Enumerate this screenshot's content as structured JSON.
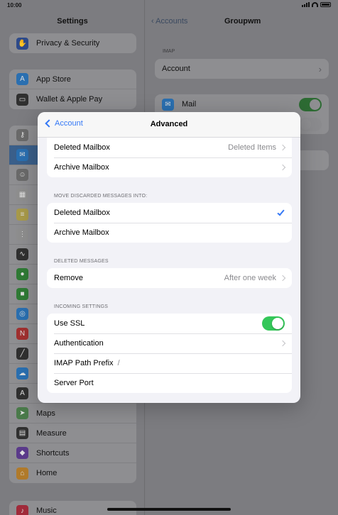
{
  "status": {
    "time": "10:00"
  },
  "sidebar": {
    "title": "Settings",
    "groups": [
      {
        "items": [
          {
            "label": "Privacy & Security",
            "icon": "hand-icon",
            "color": "#2d4a8a"
          }
        ]
      },
      {
        "items": [
          {
            "label": "App Store",
            "icon": "app-store-icon",
            "color": "#2a6fb0"
          },
          {
            "label": "Wallet & Apple Pay",
            "icon": "wallet-icon",
            "color": "#303030"
          }
        ]
      },
      {
        "items": [
          {
            "label": "",
            "icon": "key-icon",
            "color": "#6a6a6a"
          },
          {
            "label": "",
            "icon": "mail-icon",
            "color": "#2a6fb0",
            "selected": true
          },
          {
            "label": "",
            "icon": "contacts-icon",
            "color": "#6a6a6a"
          },
          {
            "label": "",
            "icon": "calendar-icon",
            "color": "#8e8e8e"
          },
          {
            "label": "",
            "icon": "notes-icon",
            "color": "#a89a4a"
          },
          {
            "label": "",
            "icon": "reminders-icon",
            "color": "#8e8e8e"
          },
          {
            "label": "",
            "icon": "voice-memos-icon",
            "color": "#303030"
          },
          {
            "label": "",
            "icon": "messages-icon",
            "color": "#2f7a35"
          },
          {
            "label": "",
            "icon": "facetime-icon",
            "color": "#2f7a35"
          },
          {
            "label": "",
            "icon": "safari-icon",
            "color": "#2a6fb0"
          },
          {
            "label": "",
            "icon": "news-icon",
            "color": "#a03030"
          },
          {
            "label": "",
            "icon": "stocks-icon",
            "color": "#303030"
          },
          {
            "label": "",
            "icon": "weather-icon",
            "color": "#2a6fb0"
          },
          {
            "label": "",
            "icon": "translate-icon",
            "color": "#303030"
          },
          {
            "label": "Maps",
            "icon": "maps-icon",
            "color": "#4a7a4a"
          },
          {
            "label": "Measure",
            "icon": "measure-icon",
            "color": "#303030"
          },
          {
            "label": "Shortcuts",
            "icon": "shortcuts-icon",
            "color": "#5a3a8a"
          },
          {
            "label": "Home",
            "icon": "home-icon",
            "color": "#b07a2a"
          }
        ]
      },
      {
        "items": [
          {
            "label": "Music",
            "icon": "music-icon",
            "color": "#a02a3a"
          }
        ]
      }
    ]
  },
  "detail": {
    "back_label": "Accounts",
    "title": "Groupwm",
    "section_label": "IMAP",
    "account_label": "Account",
    "mail_label": "Mail"
  },
  "modal": {
    "back_label": "Account",
    "title": "Advanced",
    "mailbox_rows": [
      {
        "label": "Deleted Mailbox",
        "value": "Deleted Items"
      },
      {
        "label": "Archive Mailbox",
        "value": ""
      }
    ],
    "discard_section": {
      "label": "MOVE DISCARDED MESSAGES INTO:",
      "options": [
        {
          "label": "Deleted Mailbox",
          "checked": true
        },
        {
          "label": "Archive Mailbox",
          "checked": false
        }
      ]
    },
    "deleted_section": {
      "label": "DELETED MESSAGES",
      "remove_label": "Remove",
      "remove_value": "After one week"
    },
    "incoming_section": {
      "label": "INCOMING SETTINGS",
      "use_ssl_label": "Use SSL",
      "use_ssl_on": true,
      "authentication_label": "Authentication",
      "imap_prefix_label": "IMAP Path Prefix",
      "imap_prefix_value": "/",
      "server_port_label": "Server Port"
    }
  },
  "colors": {
    "accent": "#3478f6",
    "toggle_on": "#34c759"
  }
}
